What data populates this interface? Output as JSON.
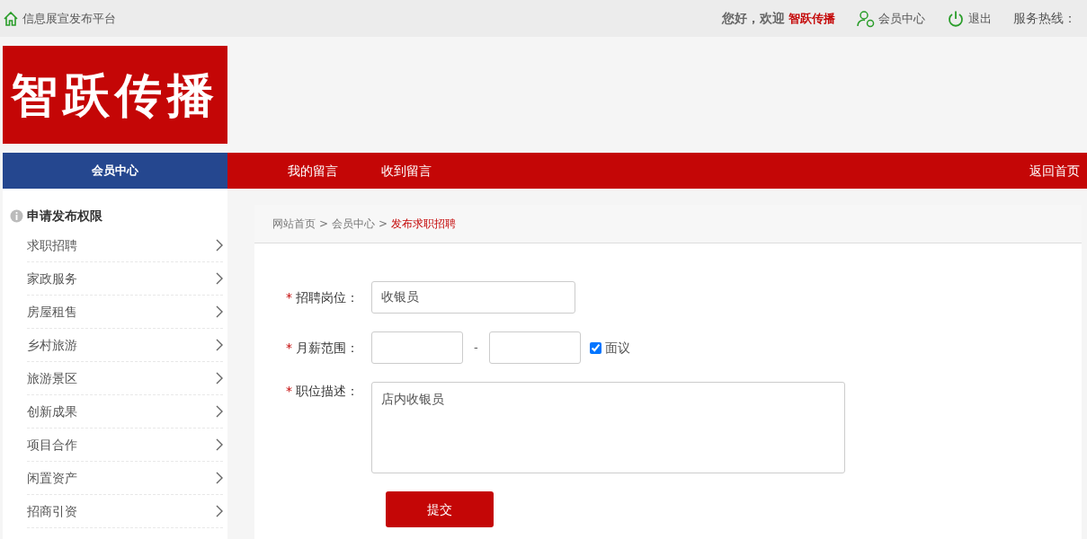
{
  "top_bar": {
    "site_link": "信息展宣发布平台",
    "greeting": "您好，欢迎",
    "user_name": "智跃传播",
    "member_link": "会员中心",
    "logout_link": "退出",
    "hotline_label": "服务热线："
  },
  "logo": {
    "text": "智跃传播"
  },
  "nav": {
    "section_title": "会员中心",
    "links": [
      "我的留言",
      "收到留言"
    ],
    "home_link": "返回首页"
  },
  "sidebar": {
    "title": "申请发布权限",
    "items": [
      "求职招聘",
      "家政服务",
      "房屋租售",
      "乡村旅游",
      "旅游景区",
      "创新成果",
      "项目合作",
      "闲置资产",
      "招商引资"
    ]
  },
  "breadcrumb": [
    {
      "label": "网站首页",
      "current": false
    },
    {
      "label": "会员中心",
      "current": false
    },
    {
      "label": "发布求职招聘",
      "current": true
    }
  ],
  "breadcrumb_separator": ">",
  "form": {
    "fields": [
      {
        "kind": "text",
        "required": true,
        "label": "招聘岗位：",
        "value": "收银员"
      },
      {
        "kind": "range",
        "required": true,
        "label": "月薪范围：",
        "separator": "-",
        "negotiable_label": "面议",
        "negotiable_checked": true
      },
      {
        "kind": "textarea",
        "required": true,
        "label": "职位描述：",
        "value": "店内收银员"
      }
    ],
    "required_mark": "*",
    "submit": "提交"
  }
}
